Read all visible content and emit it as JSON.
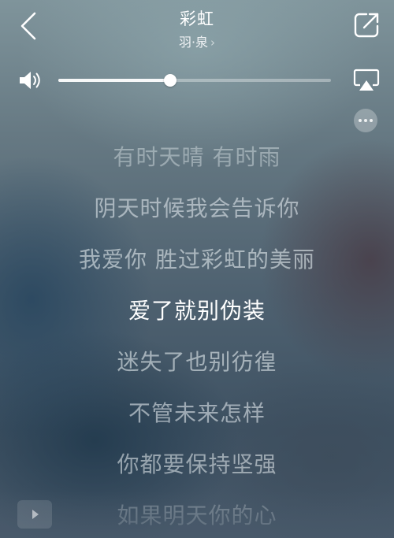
{
  "header": {
    "title": "彩虹",
    "artist": "羽·泉",
    "artist_chevron": "›"
  },
  "volume": {
    "level": 0.41
  },
  "lyrics": {
    "lines": [
      "有时天晴 有时雨",
      "阴天时候我会告诉你",
      "我爱你 胜过彩虹的美丽",
      "爱了就别伪装",
      "迷失了也别彷徨",
      "不管未来怎样",
      "你都要保持坚强",
      "如果明天你的心"
    ],
    "current_index": 3
  },
  "icons": {
    "back": "chevron-left-icon",
    "share": "share-icon",
    "volume": "speaker-icon",
    "airplay": "airplay-icon",
    "more": "more-dots-icon",
    "play": "play-icon"
  },
  "colors": {
    "current_lyric": "#ffffff",
    "other_lyric": "#e1e8ec"
  }
}
